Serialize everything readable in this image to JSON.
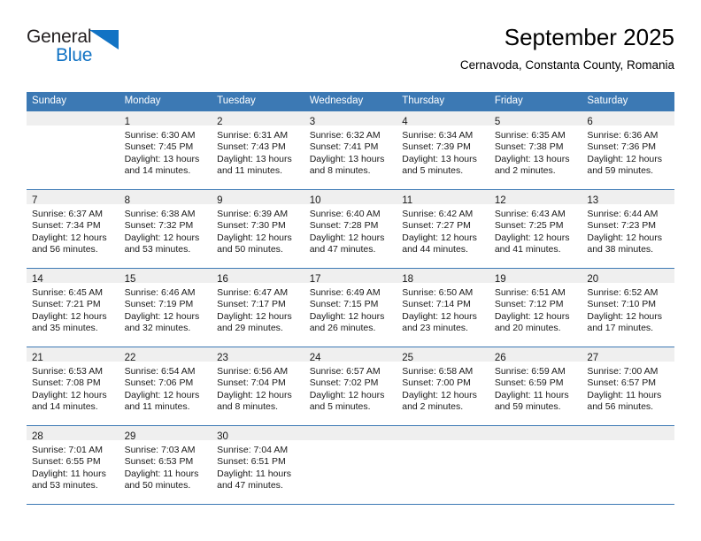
{
  "brand": {
    "word_one": "General",
    "word_two": "Blue",
    "logo_icon": "triangle-logo-icon",
    "colors": {
      "blue": "#1273c4",
      "dark": "#231f20"
    }
  },
  "header": {
    "title": "September 2025",
    "subtitle": "Cernavoda, Constanta County, Romania"
  },
  "colors": {
    "header_row": "#3c79b4",
    "daynum_band": "#efefef",
    "grid_line": "#3c79b4"
  },
  "weekdays": [
    "Sunday",
    "Monday",
    "Tuesday",
    "Wednesday",
    "Thursday",
    "Friday",
    "Saturday"
  ],
  "weeks": [
    [
      {
        "day": "",
        "lines": []
      },
      {
        "day": "1",
        "lines": [
          "Sunrise: 6:30 AM",
          "Sunset: 7:45 PM",
          "Daylight: 13 hours",
          "and 14 minutes."
        ]
      },
      {
        "day": "2",
        "lines": [
          "Sunrise: 6:31 AM",
          "Sunset: 7:43 PM",
          "Daylight: 13 hours",
          "and 11 minutes."
        ]
      },
      {
        "day": "3",
        "lines": [
          "Sunrise: 6:32 AM",
          "Sunset: 7:41 PM",
          "Daylight: 13 hours",
          "and 8 minutes."
        ]
      },
      {
        "day": "4",
        "lines": [
          "Sunrise: 6:34 AM",
          "Sunset: 7:39 PM",
          "Daylight: 13 hours",
          "and 5 minutes."
        ]
      },
      {
        "day": "5",
        "lines": [
          "Sunrise: 6:35 AM",
          "Sunset: 7:38 PM",
          "Daylight: 13 hours",
          "and 2 minutes."
        ]
      },
      {
        "day": "6",
        "lines": [
          "Sunrise: 6:36 AM",
          "Sunset: 7:36 PM",
          "Daylight: 12 hours",
          "and 59 minutes."
        ]
      }
    ],
    [
      {
        "day": "7",
        "lines": [
          "Sunrise: 6:37 AM",
          "Sunset: 7:34 PM",
          "Daylight: 12 hours",
          "and 56 minutes."
        ]
      },
      {
        "day": "8",
        "lines": [
          "Sunrise: 6:38 AM",
          "Sunset: 7:32 PM",
          "Daylight: 12 hours",
          "and 53 minutes."
        ]
      },
      {
        "day": "9",
        "lines": [
          "Sunrise: 6:39 AM",
          "Sunset: 7:30 PM",
          "Daylight: 12 hours",
          "and 50 minutes."
        ]
      },
      {
        "day": "10",
        "lines": [
          "Sunrise: 6:40 AM",
          "Sunset: 7:28 PM",
          "Daylight: 12 hours",
          "and 47 minutes."
        ]
      },
      {
        "day": "11",
        "lines": [
          "Sunrise: 6:42 AM",
          "Sunset: 7:27 PM",
          "Daylight: 12 hours",
          "and 44 minutes."
        ]
      },
      {
        "day": "12",
        "lines": [
          "Sunrise: 6:43 AM",
          "Sunset: 7:25 PM",
          "Daylight: 12 hours",
          "and 41 minutes."
        ]
      },
      {
        "day": "13",
        "lines": [
          "Sunrise: 6:44 AM",
          "Sunset: 7:23 PM",
          "Daylight: 12 hours",
          "and 38 minutes."
        ]
      }
    ],
    [
      {
        "day": "14",
        "lines": [
          "Sunrise: 6:45 AM",
          "Sunset: 7:21 PM",
          "Daylight: 12 hours",
          "and 35 minutes."
        ]
      },
      {
        "day": "15",
        "lines": [
          "Sunrise: 6:46 AM",
          "Sunset: 7:19 PM",
          "Daylight: 12 hours",
          "and 32 minutes."
        ]
      },
      {
        "day": "16",
        "lines": [
          "Sunrise: 6:47 AM",
          "Sunset: 7:17 PM",
          "Daylight: 12 hours",
          "and 29 minutes."
        ]
      },
      {
        "day": "17",
        "lines": [
          "Sunrise: 6:49 AM",
          "Sunset: 7:15 PM",
          "Daylight: 12 hours",
          "and 26 minutes."
        ]
      },
      {
        "day": "18",
        "lines": [
          "Sunrise: 6:50 AM",
          "Sunset: 7:14 PM",
          "Daylight: 12 hours",
          "and 23 minutes."
        ]
      },
      {
        "day": "19",
        "lines": [
          "Sunrise: 6:51 AM",
          "Sunset: 7:12 PM",
          "Daylight: 12 hours",
          "and 20 minutes."
        ]
      },
      {
        "day": "20",
        "lines": [
          "Sunrise: 6:52 AM",
          "Sunset: 7:10 PM",
          "Daylight: 12 hours",
          "and 17 minutes."
        ]
      }
    ],
    [
      {
        "day": "21",
        "lines": [
          "Sunrise: 6:53 AM",
          "Sunset: 7:08 PM",
          "Daylight: 12 hours",
          "and 14 minutes."
        ]
      },
      {
        "day": "22",
        "lines": [
          "Sunrise: 6:54 AM",
          "Sunset: 7:06 PM",
          "Daylight: 12 hours",
          "and 11 minutes."
        ]
      },
      {
        "day": "23",
        "lines": [
          "Sunrise: 6:56 AM",
          "Sunset: 7:04 PM",
          "Daylight: 12 hours",
          "and 8 minutes."
        ]
      },
      {
        "day": "24",
        "lines": [
          "Sunrise: 6:57 AM",
          "Sunset: 7:02 PM",
          "Daylight: 12 hours",
          "and 5 minutes."
        ]
      },
      {
        "day": "25",
        "lines": [
          "Sunrise: 6:58 AM",
          "Sunset: 7:00 PM",
          "Daylight: 12 hours",
          "and 2 minutes."
        ]
      },
      {
        "day": "26",
        "lines": [
          "Sunrise: 6:59 AM",
          "Sunset: 6:59 PM",
          "Daylight: 11 hours",
          "and 59 minutes."
        ]
      },
      {
        "day": "27",
        "lines": [
          "Sunrise: 7:00 AM",
          "Sunset: 6:57 PM",
          "Daylight: 11 hours",
          "and 56 minutes."
        ]
      }
    ],
    [
      {
        "day": "28",
        "lines": [
          "Sunrise: 7:01 AM",
          "Sunset: 6:55 PM",
          "Daylight: 11 hours",
          "and 53 minutes."
        ]
      },
      {
        "day": "29",
        "lines": [
          "Sunrise: 7:03 AM",
          "Sunset: 6:53 PM",
          "Daylight: 11 hours",
          "and 50 minutes."
        ]
      },
      {
        "day": "30",
        "lines": [
          "Sunrise: 7:04 AM",
          "Sunset: 6:51 PM",
          "Daylight: 11 hours",
          "and 47 minutes."
        ]
      },
      {
        "day": "",
        "lines": []
      },
      {
        "day": "",
        "lines": []
      },
      {
        "day": "",
        "lines": []
      },
      {
        "day": "",
        "lines": []
      }
    ]
  ]
}
